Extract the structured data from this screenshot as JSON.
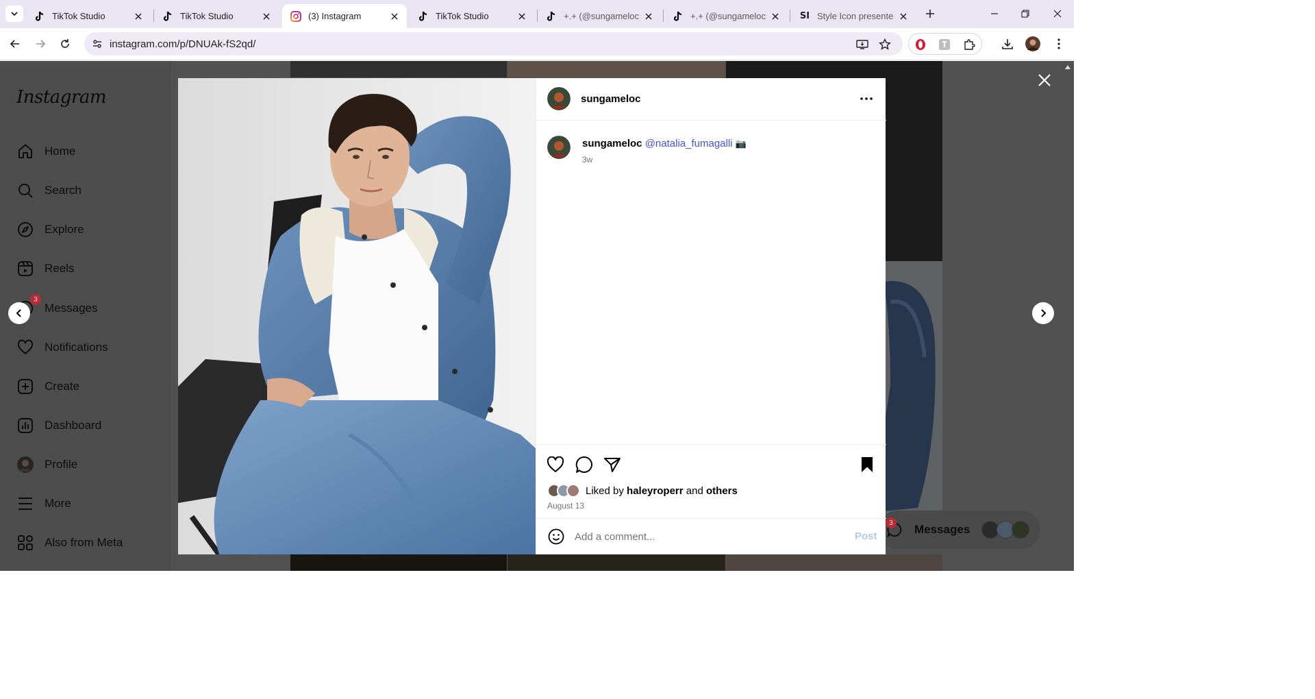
{
  "browser": {
    "tabs": [
      {
        "title": "TikTok Studio",
        "favicon": "tiktok-icon"
      },
      {
        "title": "TikTok Studio",
        "favicon": "tiktok-icon"
      },
      {
        "title": "(3) Instagram",
        "favicon": "instagram-icon",
        "active": true
      },
      {
        "title": "TikTok Studio",
        "favicon": "tiktok-icon"
      },
      {
        "title": "+.+ (@sungameloc) |",
        "favicon": "tiktok-icon"
      },
      {
        "title": "+.+ (@sungameloc) |",
        "favicon": "tiktok-icon"
      },
      {
        "title": "Style Icon presented",
        "favicon": "si-icon"
      }
    ],
    "url": "instagram.com/p/DNUAk-fS2qd/",
    "si_favicon_text": "SI"
  },
  "sidebar": {
    "logo": "Instagram",
    "items": [
      {
        "label": "Home",
        "icon": "home-icon"
      },
      {
        "label": "Search",
        "icon": "search-icon"
      },
      {
        "label": "Explore",
        "icon": "explore-compass-icon"
      },
      {
        "label": "Reels",
        "icon": "reels-icon"
      },
      {
        "label": "Messages",
        "icon": "messages-icon",
        "badge": "3"
      },
      {
        "label": "Notifications",
        "icon": "heart-icon"
      },
      {
        "label": "Create",
        "icon": "create-plus-icon"
      },
      {
        "label": "Dashboard",
        "icon": "dashboard-icon"
      },
      {
        "label": "Profile",
        "icon": "profile-avatar-icon"
      },
      {
        "label": "More",
        "icon": "hamburger-menu-icon"
      },
      {
        "label": "Also from Meta",
        "icon": "meta-apps-icon"
      }
    ]
  },
  "messages_float": {
    "label": "Messages",
    "badge": "3"
  },
  "post": {
    "username": "sungameloc",
    "caption_user": "sungameloc",
    "caption_mention": "@natalia_fumagalli",
    "caption_emoji": "📷",
    "time_ago": "3w",
    "liked_by_prefix": "Liked by",
    "liked_by_user": "haleyroperr",
    "liked_by_and": "and",
    "liked_by_others": "others",
    "date": "August 13",
    "comment_placeholder": "Add a comment...",
    "post_button": "Post"
  },
  "colors": {
    "mention": "#4150f7",
    "badge": "#ba2a37",
    "post_button_disabled": "#b3c8f3",
    "overlay_bg": "#515151"
  }
}
